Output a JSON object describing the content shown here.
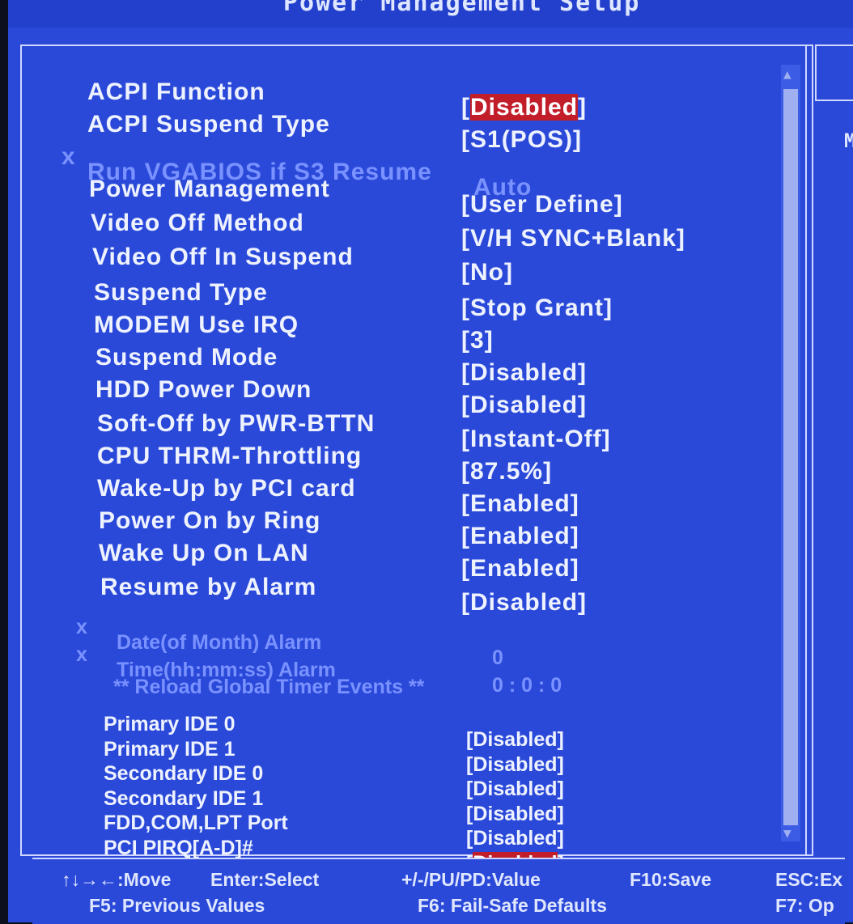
{
  "title": "Power Management Setup",
  "help_letter": "M",
  "scroll": {
    "up": "▲",
    "down": "▼"
  },
  "settings": [
    {
      "label": "ACPI Function",
      "value": "Disabled",
      "highlight": true
    },
    {
      "label": "ACPI Suspend Type",
      "value": "S1(POS)"
    },
    {
      "label": "Run VGABIOS if S3 Resume",
      "value": "Auto",
      "disabled": true
    },
    {
      "label": "Power Management",
      "value": "User Define"
    },
    {
      "label": "Video Off Method",
      "value": "V/H SYNC+Blank"
    },
    {
      "label": "Video Off In Suspend",
      "value": "No"
    },
    {
      "label": "Suspend Type",
      "value": "Stop Grant"
    },
    {
      "label": "MODEM Use IRQ",
      "value": "3"
    },
    {
      "label": "Suspend Mode",
      "value": "Disabled"
    },
    {
      "label": "HDD Power Down",
      "value": "Disabled"
    },
    {
      "label": "Soft-Off by PWR-BTTN",
      "value": "Instant-Off"
    },
    {
      "label": "CPU THRM-Throttling",
      "value": "87.5%"
    },
    {
      "label": "Wake-Up by PCI card",
      "value": "Enabled"
    },
    {
      "label": "Power On by Ring",
      "value": "Enabled"
    },
    {
      "label": "Wake Up On LAN",
      "value": "Enabled"
    },
    {
      "label": "Resume by Alarm",
      "value": "Disabled"
    }
  ],
  "alarm_settings": [
    {
      "label": "Date(of Month) Alarm",
      "value": "0"
    },
    {
      "label": "Time(hh:mm:ss) Alarm",
      "value": "0 : 0 : 0"
    }
  ],
  "reload_header": "** Reload Global Timer Events **",
  "timer_events": [
    {
      "label": "Primary IDE 0",
      "value": "Disabled"
    },
    {
      "label": "Primary IDE 1",
      "value": "Disabled"
    },
    {
      "label": "Secondary IDE 0",
      "value": "Disabled"
    },
    {
      "label": "Secondary IDE 1",
      "value": "Disabled"
    },
    {
      "label": "FDD,COM,LPT Port",
      "value": "Disabled"
    },
    {
      "label": "PCI PIRQ[A-D]#",
      "value": "Disabled",
      "highlight": true
    }
  ],
  "keys": {
    "move": "↑↓→←:Move",
    "select": "Enter:Select",
    "value": "+/-/PU/PD:Value",
    "save": "F10:Save",
    "esc": "ESC:Ex",
    "prev": "F5: Previous Values",
    "failsafe": "F6: Fail-Safe Defaults",
    "opt": "F7: Op"
  },
  "colors": {
    "background": "#2a49d9",
    "highlight": "#c11e2a",
    "dim": "#7a92ff"
  }
}
